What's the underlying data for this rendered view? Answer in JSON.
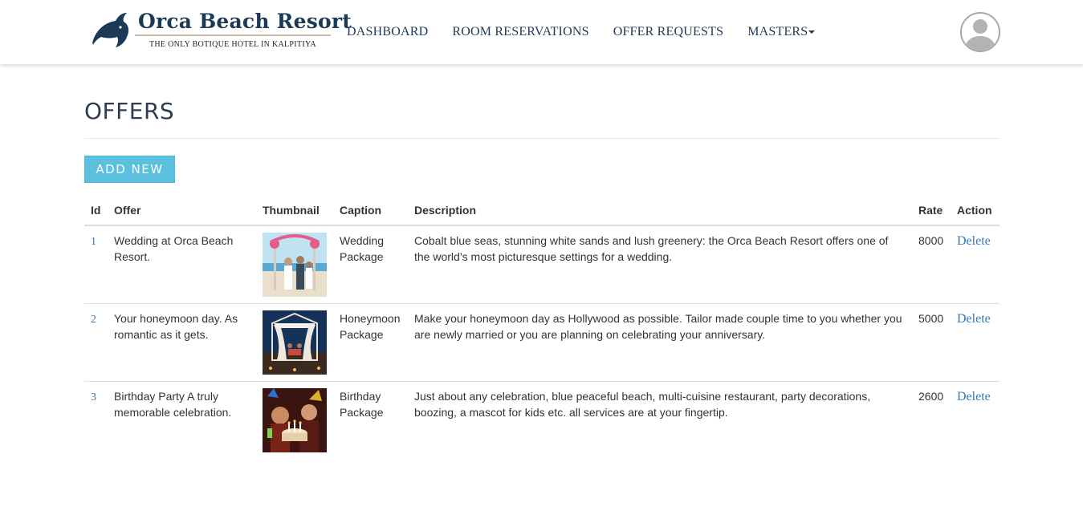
{
  "header": {
    "brand": "Orca Beach Resort",
    "tagline": "THE ONLY BOTIQUE HOTEL IN KALPITIYA",
    "nav": [
      "DASHBOARD",
      "ROOM RESERVATIONS",
      "OFFER REQUESTS",
      "MASTERS"
    ]
  },
  "page": {
    "title": "OFFERS",
    "add_label": "ADD NEW"
  },
  "table": {
    "columns": [
      "Id",
      "Offer",
      "Thumbnail",
      "Caption",
      "Description",
      "Rate",
      "Action"
    ],
    "rows": [
      {
        "id": "1",
        "offer": "Wedding at Orca Beach Resort.",
        "thumbnail": "wedding-thumbnail",
        "caption": "Wedding Package",
        "description": "Cobalt blue seas, stunning white sands and lush greenery: the Orca Beach Resort offers one of the world’s most picturesque settings for a wedding.",
        "rate": "8000",
        "action": "Delete"
      },
      {
        "id": "2",
        "offer": "Your honeymoon day. As romantic as it gets.",
        "thumbnail": "honeymoon-thumbnail",
        "caption": "Honeymoon Package",
        "description": "Make your honeymoon day as Hollywood as possible. Tailor made couple time to you whether you are newly married or you are planning on celebrating your anniversary.",
        "rate": "5000",
        "action": "Delete"
      },
      {
        "id": "3",
        "offer": "Birthday Party A truly memorable celebration.",
        "thumbnail": "birthday-thumbnail",
        "caption": "Birthday Package",
        "description": "Just about any celebration, blue peaceful beach, multi-cuisine restaurant, party decorations, boozing, a mascot for kids etc. all services are at your fingertip.",
        "rate": "2600",
        "action": "Delete"
      }
    ]
  },
  "colors": {
    "brand": "#1c3a55",
    "button": "#5bc0de",
    "link": "#337ab7"
  }
}
